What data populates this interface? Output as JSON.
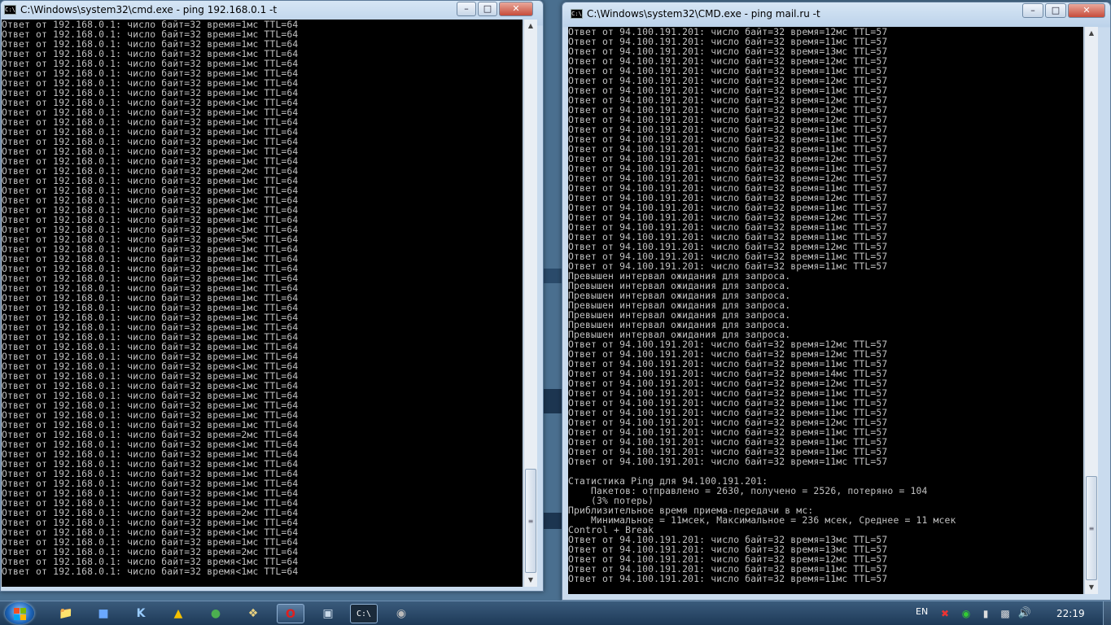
{
  "left_window": {
    "title": "C:\\Windows\\system32\\cmd.exe - ping  192.168.0.1 -t",
    "lines": [
      "Ответ от 192.168.0.1: число байт=32 время=1мс TTL=64",
      "Ответ от 192.168.0.1: число байт=32 время=1мс TTL=64",
      "Ответ от 192.168.0.1: число байт=32 время=1мс TTL=64",
      "Ответ от 192.168.0.1: число байт=32 время<1мс TTL=64",
      "Ответ от 192.168.0.1: число байт=32 время=1мс TTL=64",
      "Ответ от 192.168.0.1: число байт=32 время=1мс TTL=64",
      "Ответ от 192.168.0.1: число байт=32 время=1мс TTL=64",
      "Ответ от 192.168.0.1: число байт=32 время=1мс TTL=64",
      "Ответ от 192.168.0.1: число байт=32 время<1мс TTL=64",
      "Ответ от 192.168.0.1: число байт=32 время=1мс TTL=64",
      "Ответ от 192.168.0.1: число байт=32 время=1мс TTL=64",
      "Ответ от 192.168.0.1: число байт=32 время=1мс TTL=64",
      "Ответ от 192.168.0.1: число байт=32 время=1мс TTL=64",
      "Ответ от 192.168.0.1: число байт=32 время=1мс TTL=64",
      "Ответ от 192.168.0.1: число байт=32 время=1мс TTL=64",
      "Ответ от 192.168.0.1: число байт=32 время=2мс TTL=64",
      "Ответ от 192.168.0.1: число байт=32 время=1мс TTL=64",
      "Ответ от 192.168.0.1: число байт=32 время=1мс TTL=64",
      "Ответ от 192.168.0.1: число байт=32 время<1мс TTL=64",
      "Ответ от 192.168.0.1: число байт=32 время<1мс TTL=64",
      "Ответ от 192.168.0.1: число байт=32 время=1мс TTL=64",
      "Ответ от 192.168.0.1: число байт=32 время<1мс TTL=64",
      "Ответ от 192.168.0.1: число байт=32 время=5мс TTL=64",
      "Ответ от 192.168.0.1: число байт=32 время=1мс TTL=64",
      "Ответ от 192.168.0.1: число байт=32 время=1мс TTL=64",
      "Ответ от 192.168.0.1: число байт=32 время=1мс TTL=64",
      "Ответ от 192.168.0.1: число байт=32 время=1мс TTL=64",
      "Ответ от 192.168.0.1: число байт=32 время=1мс TTL=64",
      "Ответ от 192.168.0.1: число байт=32 время=1мс TTL=64",
      "Ответ от 192.168.0.1: число байт=32 время=1мс TTL=64",
      "Ответ от 192.168.0.1: число байт=32 время=1мс TTL=64",
      "Ответ от 192.168.0.1: число байт=32 время=1мс TTL=64",
      "Ответ от 192.168.0.1: число байт=32 время=1мс TTL=64",
      "Ответ от 192.168.0.1: число байт=32 время=1мс TTL=64",
      "Ответ от 192.168.0.1: число байт=32 время=1мс TTL=64",
      "Ответ от 192.168.0.1: число байт=32 время<1мс TTL=64",
      "Ответ от 192.168.0.1: число байт=32 время=1мс TTL=64",
      "Ответ от 192.168.0.1: число байт=32 время<1мс TTL=64",
      "Ответ от 192.168.0.1: число байт=32 время=1мс TTL=64",
      "Ответ от 192.168.0.1: число байт=32 время=1мс TTL=64",
      "Ответ от 192.168.0.1: число байт=32 время=1мс TTL=64",
      "Ответ от 192.168.0.1: число байт=32 время=1мс TTL=64",
      "Ответ от 192.168.0.1: число байт=32 время=2мс TTL=64",
      "Ответ от 192.168.0.1: число байт=32 время<1мс TTL=64",
      "Ответ от 192.168.0.1: число байт=32 время=1мс TTL=64",
      "Ответ от 192.168.0.1: число байт=32 время<1мс TTL=64",
      "Ответ от 192.168.0.1: число байт=32 время=1мс TTL=64",
      "Ответ от 192.168.0.1: число байт=32 время=1мс TTL=64",
      "Ответ от 192.168.0.1: число байт=32 время<1мс TTL=64",
      "Ответ от 192.168.0.1: число байт=32 время=1мс TTL=64",
      "Ответ от 192.168.0.1: число байт=32 время=2мс TTL=64",
      "Ответ от 192.168.0.1: число байт=32 время=1мс TTL=64",
      "Ответ от 192.168.0.1: число байт=32 время<1мс TTL=64",
      "Ответ от 192.168.0.1: число байт=32 время=1мс TTL=64",
      "Ответ от 192.168.0.1: число байт=32 время=2мс TTL=64",
      "Ответ от 192.168.0.1: число байт=32 время<1мс TTL=64",
      "Ответ от 192.168.0.1: число байт=32 время<1мс TTL=64"
    ]
  },
  "right_window": {
    "title": "C:\\Windows\\system32\\CMD.exe - ping  mail.ru -t",
    "lines": [
      "Ответ от 94.100.191.201: число байт=32 время=12мс TTL=57",
      "Ответ от 94.100.191.201: число байт=32 время=11мс TTL=57",
      "Ответ от 94.100.191.201: число байт=32 время=13мс TTL=57",
      "Ответ от 94.100.191.201: число байт=32 время=12мс TTL=57",
      "Ответ от 94.100.191.201: число байт=32 время=11мс TTL=57",
      "Ответ от 94.100.191.201: число байт=32 время=12мс TTL=57",
      "Ответ от 94.100.191.201: число байт=32 время=11мс TTL=57",
      "Ответ от 94.100.191.201: число байт=32 время=12мс TTL=57",
      "Ответ от 94.100.191.201: число байт=32 время=12мс TTL=57",
      "Ответ от 94.100.191.201: число байт=32 время=12мс TTL=57",
      "Ответ от 94.100.191.201: число байт=32 время=11мс TTL=57",
      "Ответ от 94.100.191.201: число байт=32 время=11мс TTL=57",
      "Ответ от 94.100.191.201: число байт=32 время=11мс TTL=57",
      "Ответ от 94.100.191.201: число байт=32 время=12мс TTL=57",
      "Ответ от 94.100.191.201: число байт=32 время=11мс TTL=57",
      "Ответ от 94.100.191.201: число байт=32 время=12мс TTL=57",
      "Ответ от 94.100.191.201: число байт=32 время=11мс TTL=57",
      "Ответ от 94.100.191.201: число байт=32 время=12мс TTL=57",
      "Ответ от 94.100.191.201: число байт=32 время=11мс TTL=57",
      "Ответ от 94.100.191.201: число байт=32 время=12мс TTL=57",
      "Ответ от 94.100.191.201: число байт=32 время=11мс TTL=57",
      "Ответ от 94.100.191.201: число байт=32 время=11мс TTL=57",
      "Ответ от 94.100.191.201: число байт=32 время=12мс TTL=57",
      "Ответ от 94.100.191.201: число байт=32 время=11мс TTL=57",
      "Ответ от 94.100.191.201: число байт=32 время=11мс TTL=57",
      "Превышен интервал ожидания для запроса.",
      "Превышен интервал ожидания для запроса.",
      "Превышен интервал ожидания для запроса.",
      "Превышен интервал ожидания для запроса.",
      "Превышен интервал ожидания для запроса.",
      "Превышен интервал ожидания для запроса.",
      "Превышен интервал ожидания для запроса.",
      "Ответ от 94.100.191.201: число байт=32 время=12мс TTL=57",
      "Ответ от 94.100.191.201: число байт=32 время=12мс TTL=57",
      "Ответ от 94.100.191.201: число байт=32 время=11мс TTL=57",
      "Ответ от 94.100.191.201: число байт=32 время=14мс TTL=57",
      "Ответ от 94.100.191.201: число байт=32 время=12мс TTL=57",
      "Ответ от 94.100.191.201: число байт=32 время=11мс TTL=57",
      "Ответ от 94.100.191.201: число байт=32 время=11мс TTL=57",
      "Ответ от 94.100.191.201: число байт=32 время=11мс TTL=57",
      "Ответ от 94.100.191.201: число байт=32 время=12мс TTL=57",
      "Ответ от 94.100.191.201: число байт=32 время=11мс TTL=57",
      "Ответ от 94.100.191.201: число байт=32 время=11мс TTL=57",
      "Ответ от 94.100.191.201: число байт=32 время=11мс TTL=57",
      "Ответ от 94.100.191.201: число байт=32 время=11мс TTL=57",
      "",
      "Статистика Ping для 94.100.191.201:",
      "    Пакетов: отправлено = 2630, получено = 2526, потеряно = 104",
      "    (3% потерь)",
      "Приблизительное время приема-передачи в мс:",
      "    Минимальное = 11мсек, Максимальное = 236 мсек, Среднее = 11 мсек",
      "Control + Break",
      "Ответ от 94.100.191.201: число байт=32 время=13мс TTL=57",
      "Ответ от 94.100.191.201: число байт=32 время=13мс TTL=57",
      "Ответ от 94.100.191.201: число байт=32 время=12мс TTL=57",
      "Ответ от 94.100.191.201: число байт=32 время=11мс TTL=57",
      "Ответ от 94.100.191.201: число байт=32 время=11мс TTL=57"
    ]
  },
  "taskbar": {
    "language": "EN",
    "clock": "22:19"
  }
}
